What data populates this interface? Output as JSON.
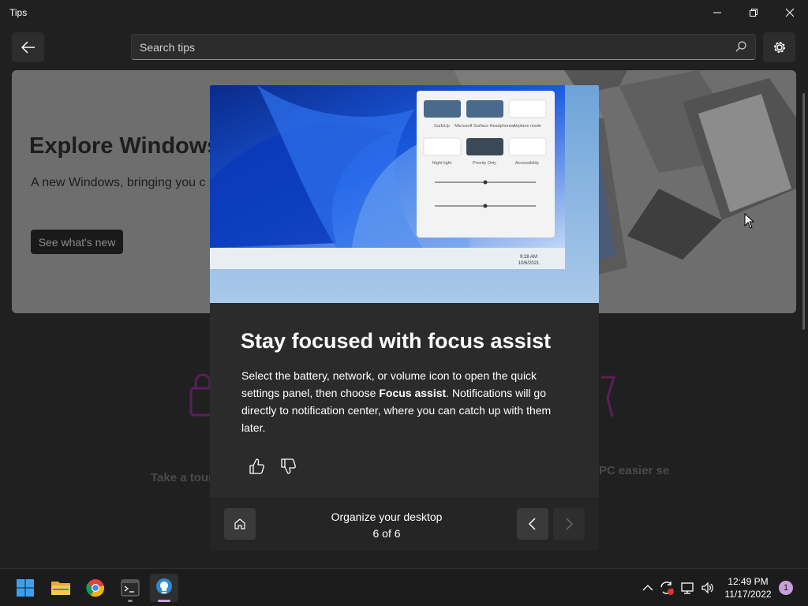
{
  "window": {
    "title": "Tips"
  },
  "toolbar": {
    "search_placeholder": "Search tips"
  },
  "hero": {
    "title": "Explore Windows",
    "description": "A new Windows, bringing you c love.",
    "button_label": "See what's new"
  },
  "background_cards": {
    "left_title": "Take a tour",
    "right_title": "PC easier se"
  },
  "tip": {
    "title": "Stay focused with focus assist",
    "body_before": "Select the battery, network, or volume icon to open the quick settings panel, then choose ",
    "body_bold": "Focus assist",
    "body_after": ". Notifications will go directly to notification center, where you can catch up with them later."
  },
  "quick_settings": {
    "tiles": [
      "SurfsUp",
      "Microsoft Surface Headphones",
      "Airplane mode",
      "Night light",
      "Priority Only",
      "Accessibility"
    ],
    "time": "9:28 AM",
    "date": "10/6/2021"
  },
  "footer": {
    "collection_title": "Organize your desktop",
    "position_text": "6 of 6"
  },
  "taskbar": {
    "apps": [
      "start-icon",
      "file-explorer-icon",
      "chrome-icon",
      "terminal-icon",
      "tips-icon"
    ],
    "time": "12:49 PM",
    "date": "11/17/2022",
    "notification_count": "1"
  },
  "colors": {
    "accent": "#c9a0dc",
    "background": "#202020",
    "dialog": "#2b2b2b"
  }
}
